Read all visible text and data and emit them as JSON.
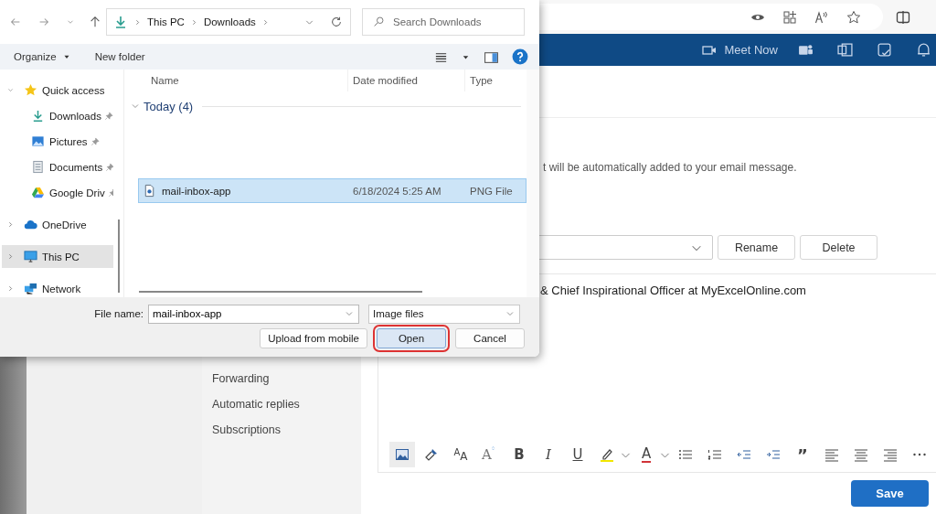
{
  "app_header": {
    "meet_now": "Meet Now"
  },
  "settings_nav": {
    "items": [
      {
        "label": "Forwarding"
      },
      {
        "label": "Automatic replies"
      },
      {
        "label": "Subscriptions"
      }
    ]
  },
  "signature": {
    "hint": "t will be automatically added to your email message.",
    "rename_button": "Rename",
    "delete_button": "Delete",
    "text": "& Chief Inspirational Officer at MyExcelOnline.com",
    "toolbar": [
      {
        "kind": "image",
        "selected": true
      },
      {
        "kind": "painter",
        "selected": false
      },
      {
        "kind": "fontsize",
        "label": "$^{A}$A",
        "selected": false
      },
      {
        "kind": "grow",
        "label": "A",
        "selected": false
      },
      {
        "kind": "bold",
        "label": "B",
        "selected": false
      },
      {
        "kind": "italic",
        "label": "I",
        "selected": false
      },
      {
        "kind": "underline",
        "label": "U",
        "selected": false
      },
      {
        "kind": "highlight",
        "selected": false
      },
      {
        "kind": "fontcolor",
        "label": "A",
        "selected": false
      },
      {
        "kind": "bullets",
        "selected": false
      },
      {
        "kind": "numbering",
        "selected": false
      },
      {
        "kind": "outdent",
        "selected": false
      },
      {
        "kind": "indent",
        "selected": false
      },
      {
        "kind": "quote",
        "label": "”",
        "selected": false
      },
      {
        "kind": "alignleft",
        "selected": false
      },
      {
        "kind": "center",
        "selected": false
      },
      {
        "kind": "alignright",
        "selected": false
      },
      {
        "kind": "more",
        "selected": false
      }
    ]
  },
  "save_button": "Save",
  "dialog": {
    "address": [
      "This PC",
      "Downloads"
    ],
    "search": {
      "placeholder": "Search Downloads"
    },
    "toolbar": {
      "organize": "Organize",
      "new_folder": "New folder"
    },
    "nav_pane": [
      {
        "label": "Quick access",
        "kind": "star",
        "expanded": true,
        "selected": false,
        "children": [
          {
            "label": "Downloads",
            "kind": "download",
            "pinned": true
          },
          {
            "label": "Pictures",
            "kind": "pictures",
            "pinned": true
          },
          {
            "label": "Documents",
            "kind": "documents",
            "pinned": true
          },
          {
            "label": "Google Driv",
            "kind": "drive",
            "pinned": true
          }
        ]
      },
      {
        "label": "OneDrive",
        "kind": "cloud",
        "expanded": false,
        "selected": false
      },
      {
        "label": "This PC",
        "kind": "pc",
        "expanded": false,
        "selected": true
      },
      {
        "label": "Network",
        "kind": "network",
        "expanded": false,
        "selected": false
      }
    ],
    "columns": [
      "Name",
      "Date modified",
      "Type"
    ],
    "groups": [
      {
        "label": "Today (4)",
        "expanded": true,
        "files": [
          {
            "name": "mail-inbox-app",
            "date": "6/18/2024 5:25 AM",
            "type": "PNG File",
            "selected": true
          }
        ]
      }
    ],
    "file_name": {
      "label": "File name:",
      "value": "mail-inbox-app"
    },
    "file_type": "Image files",
    "buttons": [
      {
        "label": "Upload from mobile",
        "default": false,
        "highlighted": false
      },
      {
        "label": "Open",
        "default": true,
        "highlighted": true
      },
      {
        "label": "Cancel",
        "default": false,
        "highlighted": false
      }
    ]
  }
}
